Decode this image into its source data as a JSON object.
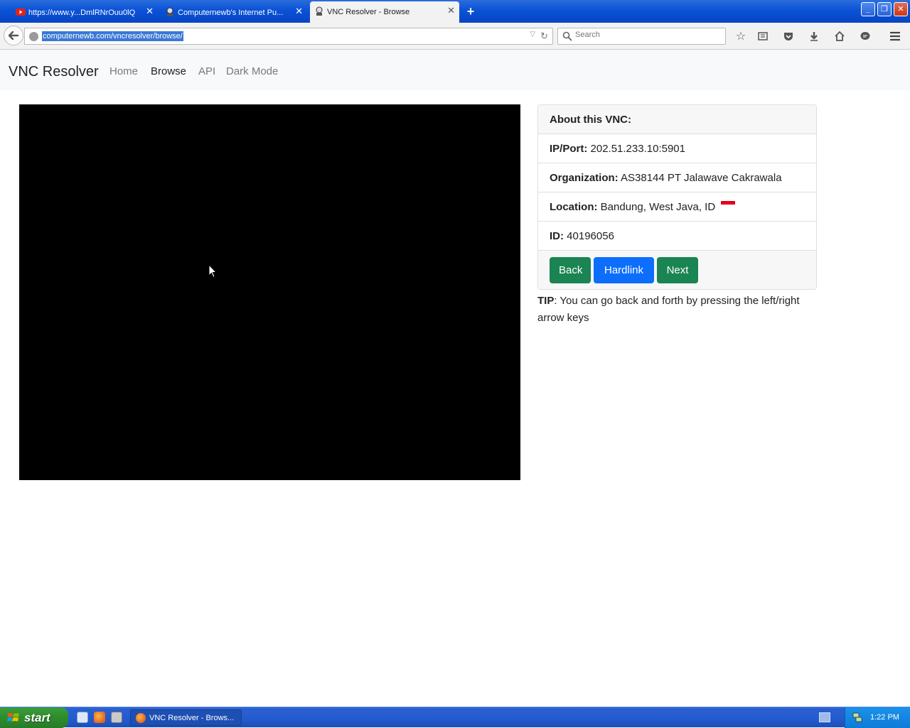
{
  "browser": {
    "tabs": [
      {
        "label": "https://www.y...DmlRNrOuu0lQ",
        "icon": "youtube-icon",
        "active": false
      },
      {
        "label": "Computernewb's Internet Pu...",
        "icon": "site-favicon",
        "active": false
      },
      {
        "label": "VNC Resolver - Browse",
        "icon": "site-favicon",
        "active": true
      }
    ],
    "url": "computernewb.com/vncresolver/browse/",
    "search_placeholder": "Search"
  },
  "site": {
    "brand": "VNC Resolver",
    "nav": [
      {
        "label": "Home",
        "active": false
      },
      {
        "label": "Browse",
        "active": true
      },
      {
        "label": "API",
        "active": false
      },
      {
        "label": "Dark Mode",
        "active": false
      }
    ]
  },
  "vnc_info": {
    "header": "About this VNC:",
    "ip_port_label": "IP/Port:",
    "ip_port": "202.51.233.10:5901",
    "organization_label": "Organization:",
    "organization": "AS38144 PT Jalawave Cakrawala",
    "location_label": "Location:",
    "location": "Bandung, West Java, ID",
    "id_label": "ID:",
    "id": "40196056",
    "buttons": {
      "back": "Back",
      "hardlink": "Hardlink",
      "next": "Next"
    },
    "colors": {
      "green_button": "#1a8453",
      "blue_button": "#0d6efd"
    }
  },
  "tip": {
    "label": "TIP",
    "text": ": You can go back and forth by pressing the left/right arrow keys"
  },
  "taskbar": {
    "start_label": "start",
    "task_label": "VNC Resolver - Brows...",
    "clock": "1:22 PM"
  }
}
